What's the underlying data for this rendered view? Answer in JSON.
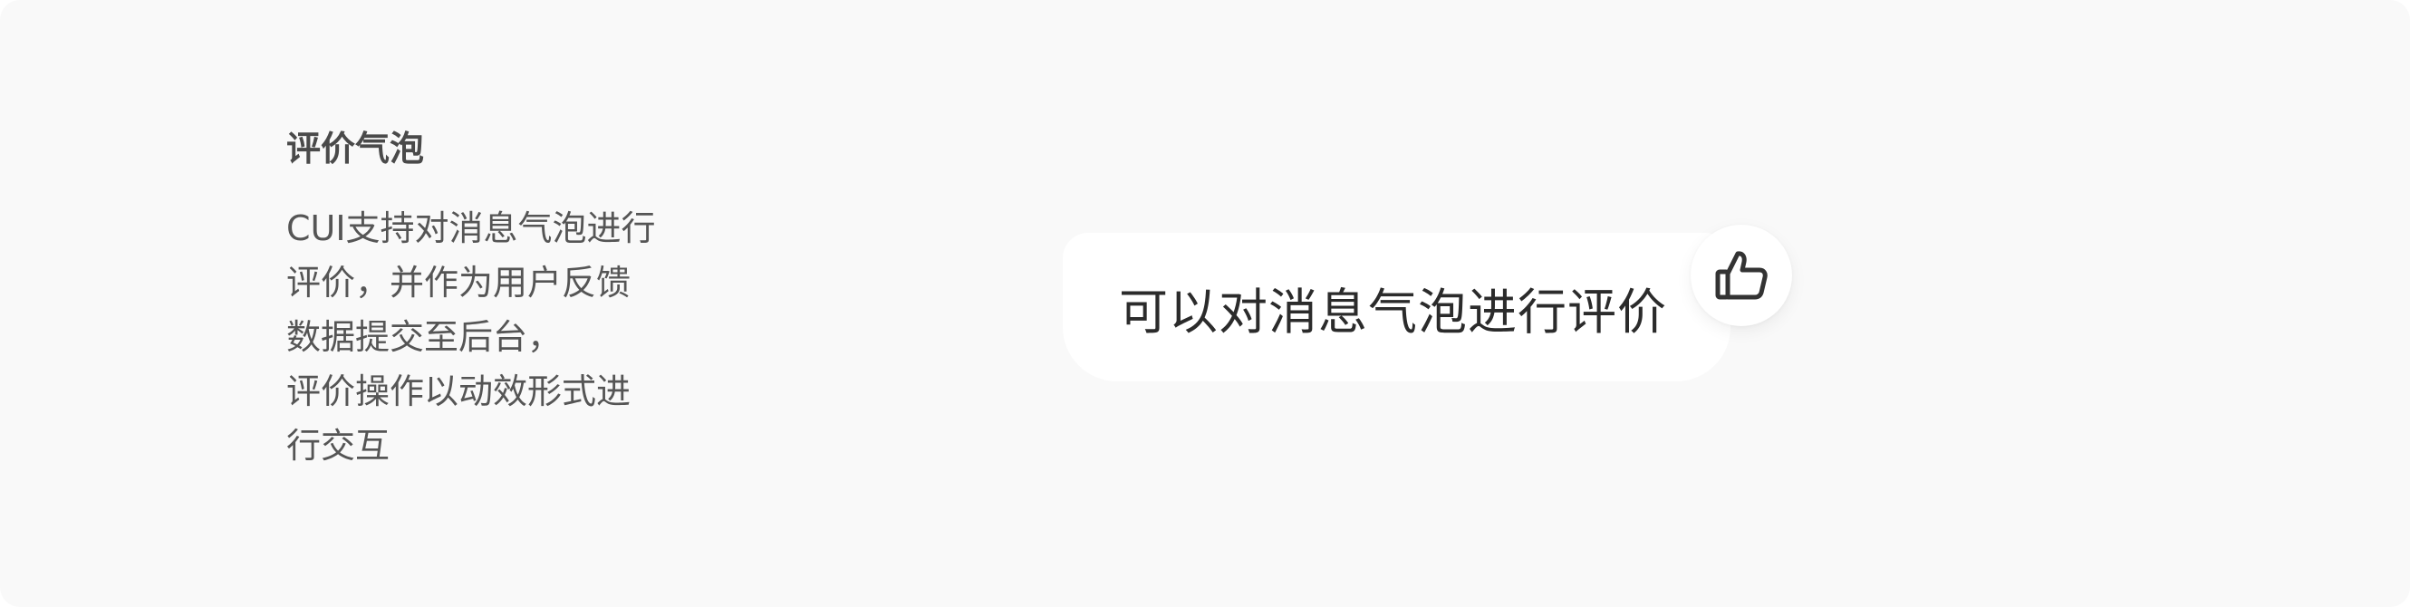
{
  "description": {
    "title": "评价气泡",
    "lines": [
      "CUI支持对消息气泡进行",
      "评价，并作为用户反馈",
      "数据提交至后台，",
      "评价操作以动效形式进",
      "行交互"
    ]
  },
  "bubble": {
    "text": "可以对消息气泡进行评价"
  },
  "rating": {
    "icon": "thumbs-up-icon"
  },
  "colors": {
    "page_background": "#f9f9f9",
    "bubble_background": "#ffffff",
    "text_primary": "#2b2b2b",
    "text_secondary": "#555555",
    "icon_stroke": "#333333"
  }
}
